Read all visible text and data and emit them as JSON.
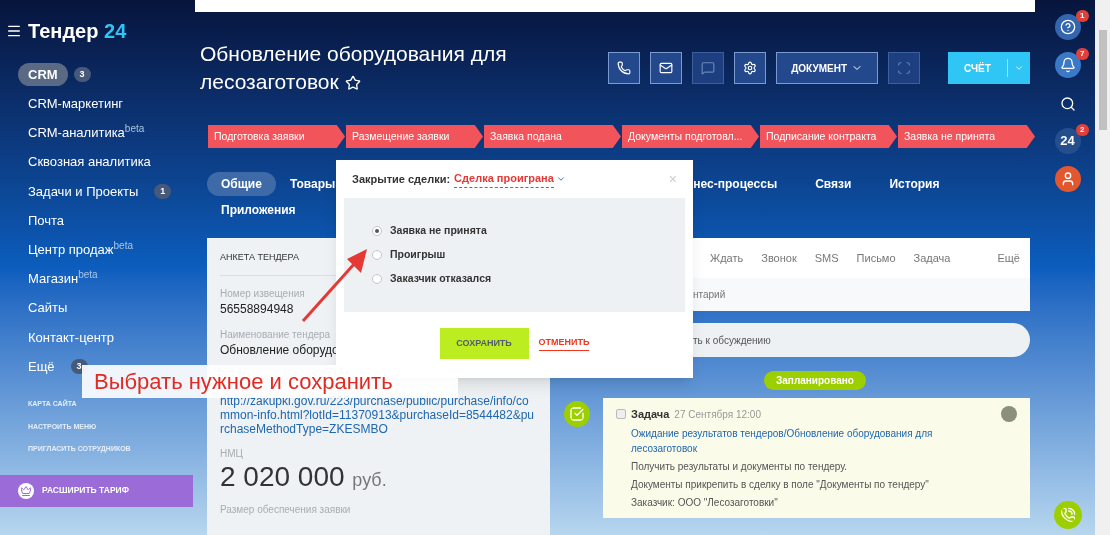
{
  "sidebar": {
    "logo": {
      "text": "Тендер",
      "accent": "24"
    },
    "items": [
      {
        "label": "CRM",
        "badge": "3",
        "selected": true
      },
      {
        "label": "CRM-маркетинг",
        "selected": false
      },
      {
        "label": "CRM-аналитика",
        "sup": "beta",
        "selected": false
      },
      {
        "label": "Сквозная аналитика",
        "selected": false
      },
      {
        "label": "Задачи и Проекты",
        "badge": "1",
        "selected": false
      },
      {
        "label": "Почта",
        "selected": false
      },
      {
        "label": "Центр продаж",
        "sup": "beta",
        "selected": false
      },
      {
        "label": "Магазин",
        "sup": "beta",
        "selected": false
      },
      {
        "label": "Сайты",
        "selected": false
      },
      {
        "label": "Контакт-центр",
        "selected": false
      },
      {
        "label": "Ещё",
        "badge": "3",
        "selected": false
      }
    ],
    "links": [
      "КАРТА САЙТА",
      "НАСТРОИТЬ МЕНЮ",
      "ПРИГЛАСИТЬ СОТРУДНИКОВ"
    ],
    "upgrade": "РАСШИРИТЬ ТАРИФ"
  },
  "header": {
    "title": "Обновление оборудования для лесозаготовок",
    "document_button": "ДОКУМЕНТ",
    "invoice_button": "СЧЁТ"
  },
  "stages": [
    "Подготовка заявки",
    "Размещение заявки",
    "Заявка подана",
    "Документы подготовл...",
    "Подписание контракта",
    "Заявка не принята"
  ],
  "tabs": [
    {
      "label": "Общие",
      "selected": true
    },
    {
      "label": "Товары",
      "selected": false
    },
    {
      "label": "нес-процессы",
      "selected": false
    },
    {
      "label": "Связи",
      "selected": false
    },
    {
      "label": "История",
      "selected": false
    },
    {
      "label": "Приложения",
      "selected": false
    }
  ],
  "card": {
    "title": "АНКЕТА ТЕНДЕРА",
    "fields": [
      {
        "label": "Номер извещения",
        "value": "56558894948",
        "kind": "text"
      },
      {
        "label": "Наименование тендера",
        "value": "Обновление оборудо",
        "kind": "text"
      },
      {
        "value": "http://zakupki.gov.ru/223/purchase/public/purchase/info/common-info.html?lotId=11370913&purchaseId=8544482&purchaseMethodType=ZKESMBO",
        "kind": "link"
      }
    ],
    "price_label": "НМЦ",
    "price": "2 020 000",
    "currency": "руб.",
    "next_label": "Размер обеспечения заявки"
  },
  "activity": {
    "tabs": [
      "Ждать",
      "Звонок",
      "SMS",
      "Письмо",
      "Задача",
      "Ещё"
    ],
    "comment": "нтарий",
    "discussion": "ть к обсуждению",
    "planned": "Запланировано",
    "task": {
      "kind_label": "Задача",
      "date": "27 Сентября 12:00",
      "done": false,
      "title": "Ожидание результатов тендеров/Обновление оборудования для лесозаготовок",
      "lines": [
        "Получить результаты и документы по тендеру.",
        "Документы прикрепить в сделку в поле \"Документы по тендеру\"",
        "Заказчик: ООО \"Лесозаготовки\""
      ]
    }
  },
  "dialog": {
    "title": "Закрытие сделки:",
    "status": "Сделка проиграна",
    "close": "×",
    "options": [
      {
        "label": "Заявка не принята",
        "selected": true
      },
      {
        "label": "Проигрыш",
        "selected": false
      },
      {
        "label": "Заказчик отказался",
        "selected": false
      }
    ],
    "save": "СОХРАНИТЬ",
    "cancel": "ОТМЕНИТЬ"
  },
  "annotation": "Выбрать нужное и сохранить",
  "right_bar": {
    "help_badge": "1",
    "bell_badge": "7",
    "app_label": "24",
    "app_badge": "2"
  }
}
